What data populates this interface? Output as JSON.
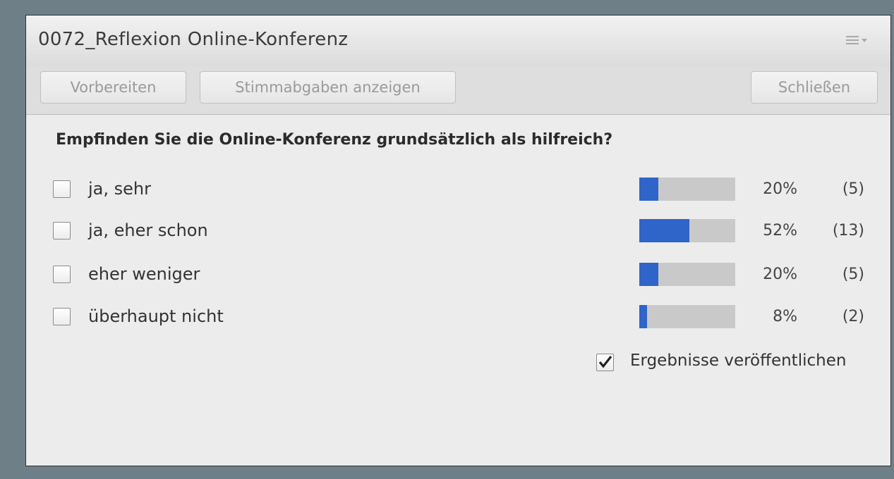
{
  "window": {
    "title": "0072_Reflexion Online-Konferenz",
    "menu_icon": "hamburger-menu-icon"
  },
  "toolbar": {
    "prepare_label": "Vorbereiten",
    "show_votes_label": "Stimmabgaben anzeigen",
    "close_label": "Schließen"
  },
  "poll": {
    "question": "Empfinden Sie die Online-Konferenz grundsätzlich als hilfreich?",
    "options": [
      {
        "label": "ja, sehr",
        "percent": "20%",
        "count": "(5)",
        "fraction": 0.2
      },
      {
        "label": "ja, eher schon",
        "percent": "52%",
        "count": "(13)",
        "fraction": 0.52
      },
      {
        "label": "eher weniger",
        "percent": "20%",
        "count": "(5)",
        "fraction": 0.2
      },
      {
        "label": "überhaupt nicht",
        "percent": "8%",
        "count": "(2)",
        "fraction": 0.08
      }
    ],
    "publish_label": "Ergebnisse veröffentlichen",
    "publish_checked": true
  },
  "colors": {
    "bar_fill": "#2f64c8",
    "bar_track": "#c9c9c9"
  }
}
